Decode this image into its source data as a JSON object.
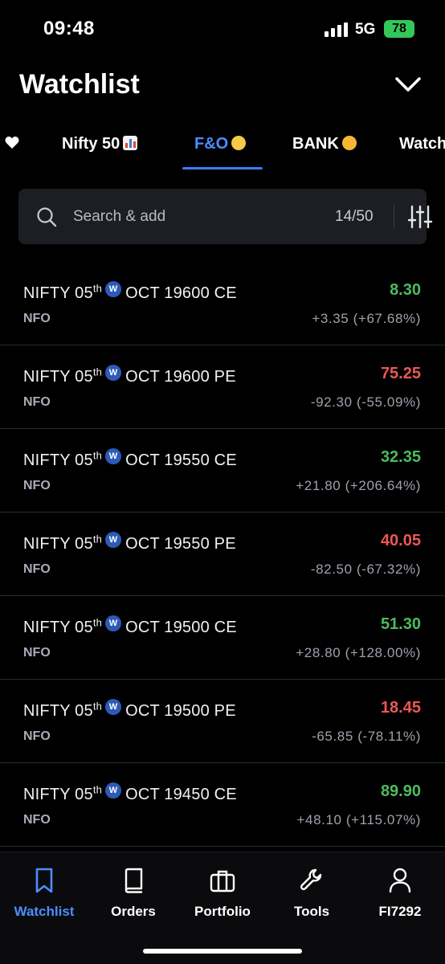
{
  "status": {
    "time": "09:48",
    "network": "5G",
    "battery": "78"
  },
  "header": {
    "title": "Watchlist"
  },
  "tabs": [
    {
      "label": "Nifty 50",
      "emoji": "chart-emoji"
    },
    {
      "label": "F&O",
      "emoji": "rolling-eyes-emoji",
      "active": true
    },
    {
      "label": "BANK",
      "emoji": "heart-eyes-emoji"
    },
    {
      "label": "Watch"
    }
  ],
  "search": {
    "placeholder": "Search & add",
    "count": "14/50"
  },
  "rows": [
    {
      "prefix": "NIFTY 05",
      "sup": "th",
      "badge": "W",
      "suffix": "OCT 19600 CE",
      "exchange": "NFO",
      "ltp": "8.30",
      "change": "+3.35 (+67.68%)",
      "dir": "up"
    },
    {
      "prefix": "NIFTY 05",
      "sup": "th",
      "badge": "W",
      "suffix": "OCT 19600 PE",
      "exchange": "NFO",
      "ltp": "75.25",
      "change": "-92.30 (-55.09%)",
      "dir": "down"
    },
    {
      "prefix": "NIFTY 05",
      "sup": "th",
      "badge": "W",
      "suffix": "OCT 19550 CE",
      "exchange": "NFO",
      "ltp": "32.35",
      "change": "+21.80 (+206.64%)",
      "dir": "up"
    },
    {
      "prefix": "NIFTY 05",
      "sup": "th",
      "badge": "W",
      "suffix": "OCT 19550 PE",
      "exchange": "NFO",
      "ltp": "40.05",
      "change": "-82.50 (-67.32%)",
      "dir": "down"
    },
    {
      "prefix": "NIFTY 05",
      "sup": "th",
      "badge": "W",
      "suffix": "OCT 19500 CE",
      "exchange": "NFO",
      "ltp": "51.30",
      "change": "+28.80 (+128.00%)",
      "dir": "up"
    },
    {
      "prefix": "NIFTY 05",
      "sup": "th",
      "badge": "W",
      "suffix": "OCT 19500 PE",
      "exchange": "NFO",
      "ltp": "18.45",
      "change": "-65.85 (-78.11%)",
      "dir": "down"
    },
    {
      "prefix": "NIFTY 05",
      "sup": "th",
      "badge": "W",
      "suffix": "OCT 19450 CE",
      "exchange": "NFO",
      "ltp": "89.90",
      "change": "+48.10 (+115.07%)",
      "dir": "up"
    }
  ],
  "nav": [
    {
      "label": "Watchlist",
      "icon": "bookmark-icon",
      "active": true
    },
    {
      "label": "Orders",
      "icon": "book-icon"
    },
    {
      "label": "Portfolio",
      "icon": "briefcase-icon"
    },
    {
      "label": "Tools",
      "icon": "wrench-icon"
    },
    {
      "label": "FI7292",
      "icon": "user-icon"
    }
  ],
  "colors": {
    "accent": "#4d8dff",
    "up": "#4cbb5e",
    "down": "#eb5757",
    "battery": "#34c759"
  }
}
